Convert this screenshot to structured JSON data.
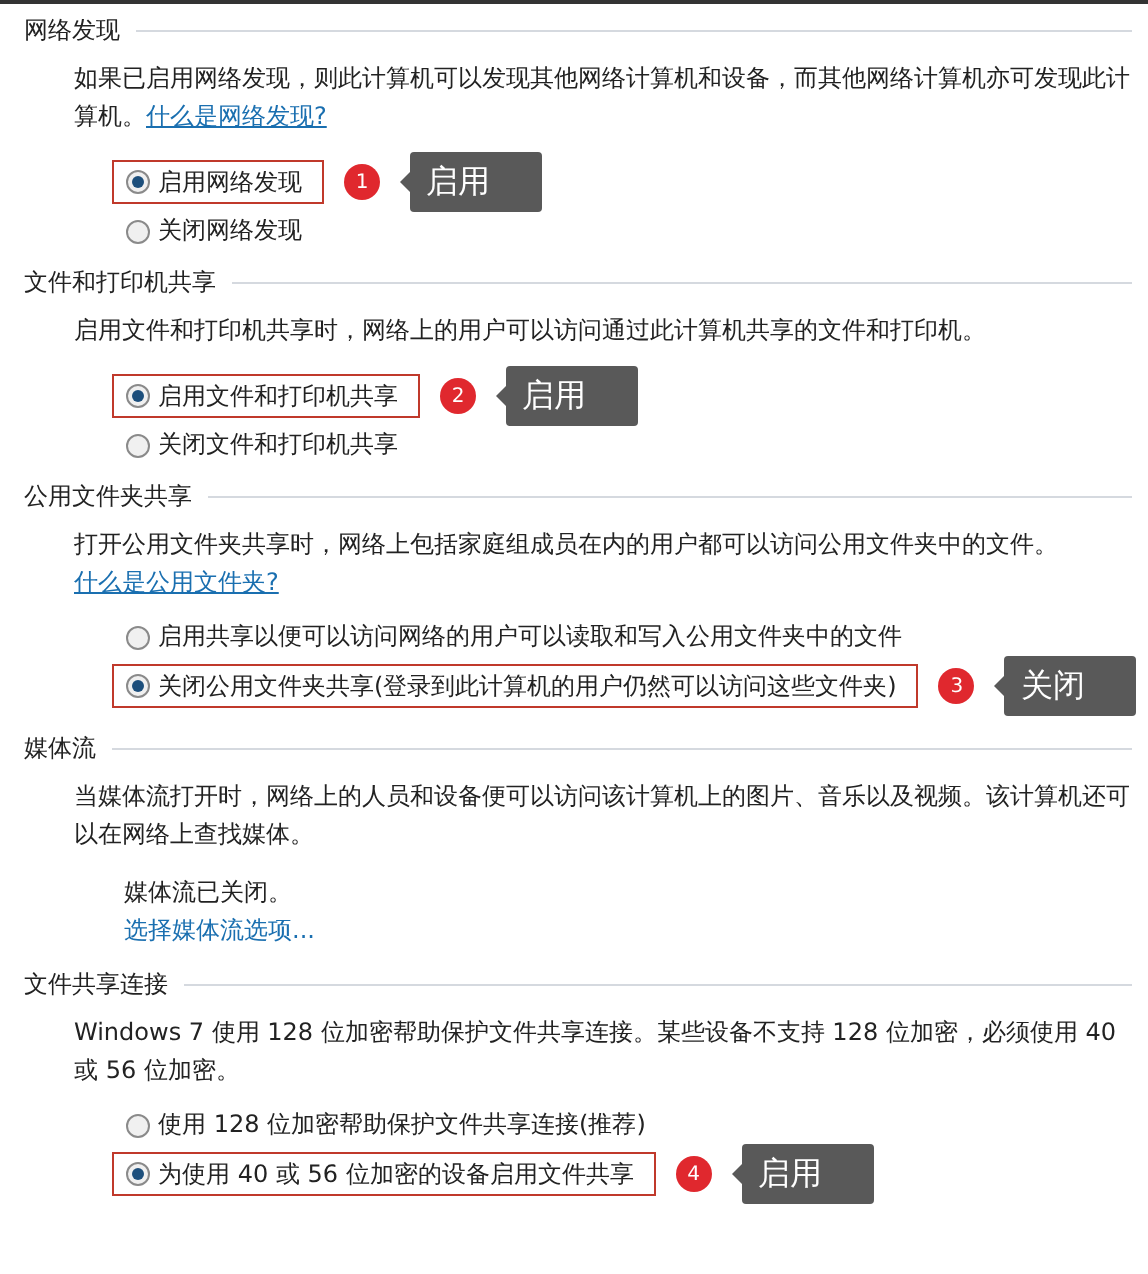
{
  "sections": [
    {
      "title": "网络发现",
      "description": {
        "text": "如果已启用网络发现，则此计算机可以发现其他网络计算机和设备，而其他网络计算机亦可发现此计算机。",
        "link": "什么是网络发现?"
      },
      "options": [
        {
          "label": "启用网络发现",
          "selected": true,
          "highlighted": true,
          "callout": {
            "number": "1",
            "text": "启用"
          }
        },
        {
          "label": "关闭网络发现",
          "selected": false,
          "highlighted": false
        }
      ]
    },
    {
      "title": "文件和打印机共享",
      "description": {
        "text": "启用文件和打印机共享时，网络上的用户可以访问通过此计算机共享的文件和打印机。"
      },
      "options": [
        {
          "label": "启用文件和打印机共享",
          "selected": true,
          "highlighted": true,
          "callout": {
            "number": "2",
            "text": "启用"
          }
        },
        {
          "label": "关闭文件和打印机共享",
          "selected": false,
          "highlighted": false
        }
      ]
    },
    {
      "title": "公用文件夹共享",
      "description": {
        "text": "打开公用文件夹共享时，网络上包括家庭组成员在内的用户都可以访问公用文件夹中的文件。",
        "link": "什么是公用文件夹?"
      },
      "options": [
        {
          "label": "启用共享以便可以访问网络的用户可以读取和写入公用文件夹中的文件",
          "selected": false,
          "highlighted": false
        },
        {
          "label": "关闭公用文件夹共享(登录到此计算机的用户仍然可以访问这些文件夹)",
          "selected": true,
          "highlighted": true,
          "callout": {
            "number": "3",
            "text": "关闭"
          }
        }
      ]
    },
    {
      "title": "媒体流",
      "description": {
        "text": "当媒体流打开时，网络上的人员和设备便可以访问该计算机上的图片、音乐以及视频。该计算机还可以在网络上查找媒体。"
      },
      "status": "媒体流已关闭。",
      "status_link": "选择媒体流选项..."
    },
    {
      "title": "文件共享连接",
      "description": {
        "text": "Windows 7 使用 128 位加密帮助保护文件共享连接。某些设备不支持 128 位加密，必须使用 40 或 56 位加密。"
      },
      "options": [
        {
          "label": "使用 128 位加密帮助保护文件共享连接(推荐)",
          "selected": false,
          "highlighted": false
        },
        {
          "label": "为使用 40 或 56 位加密的设备启用文件共享",
          "selected": true,
          "highlighted": true,
          "callout": {
            "number": "4",
            "text": "启用"
          }
        }
      ]
    }
  ]
}
